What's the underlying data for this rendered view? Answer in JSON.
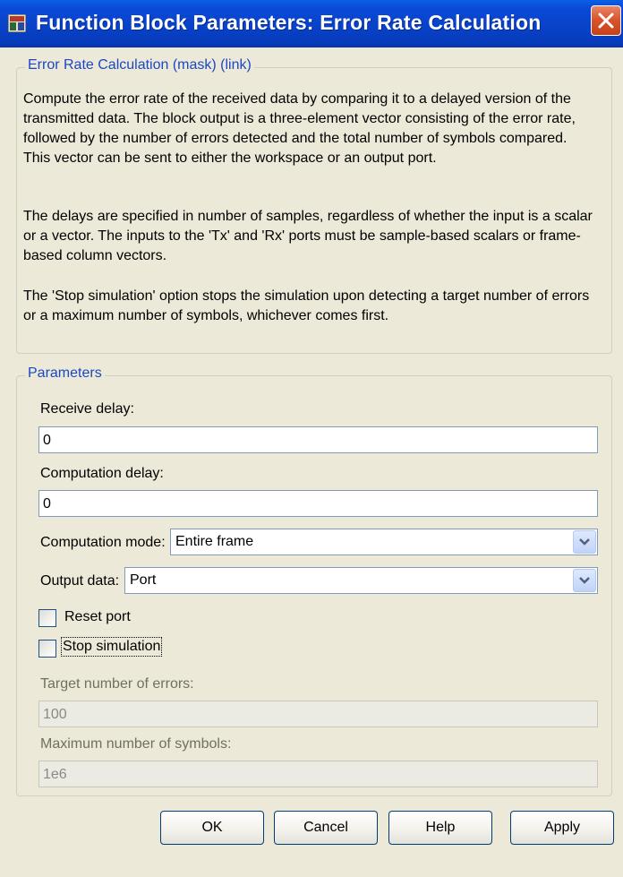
{
  "window": {
    "title": "Function Block Parameters: Error Rate Calculation"
  },
  "mask": {
    "legend": "Error Rate Calculation (mask) (link)",
    "paragraph1": "Compute the error rate of the received data by comparing it to a delayed version of the transmitted data. The block output is a three-element vector consisting of the error rate, followed by the number of errors detected and the total number of symbols compared. This vector can be sent to either the workspace or an output port.",
    "paragraph2": "The delays are specified in number of samples, regardless of whether the input is a scalar or a vector. The inputs to the 'Tx' and 'Rx' ports must be sample-based scalars or frame-based column vectors.",
    "paragraph3": "The 'Stop simulation' option stops the simulation upon detecting a target number of errors or a maximum number of symbols, whichever comes first."
  },
  "parameters": {
    "legend": "Parameters",
    "receive_delay": {
      "label": "Receive delay:",
      "value": "0"
    },
    "computation_delay": {
      "label": "Computation delay:",
      "value": "0"
    },
    "computation_mode": {
      "label": "Computation mode:",
      "value": "Entire frame"
    },
    "output_data": {
      "label": "Output data:",
      "value": "Port"
    },
    "reset_port": {
      "label": "Reset port",
      "checked": false
    },
    "stop_simulation": {
      "label": "Stop simulation",
      "checked": false
    },
    "target_errors": {
      "label": "Target number of errors:",
      "value": "100",
      "enabled": false
    },
    "max_symbols": {
      "label": "Maximum number of symbols:",
      "value": "1e6",
      "enabled": false
    }
  },
  "buttons": {
    "ok": "OK",
    "cancel": "Cancel",
    "help": "Help",
    "apply": "Apply"
  },
  "icons": {
    "title": "simulink-block-icon",
    "close": "close-icon",
    "dropdown": "chevron-down-icon"
  },
  "colors": {
    "titlebar": "#0842c8",
    "legend_text": "#1a48c4",
    "close_button": "#d9552d",
    "dialog_background": "#ece9d8"
  }
}
